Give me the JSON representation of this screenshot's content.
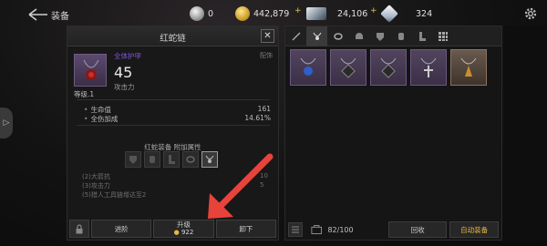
{
  "topbar": {
    "title": "装备",
    "currencies": [
      {
        "name": "silver-orb",
        "value": "0"
      },
      {
        "name": "gold-coin",
        "value": "442,879"
      },
      {
        "name": "crystal",
        "value": "24,106"
      },
      {
        "name": "diamond",
        "value": "324"
      }
    ],
    "plus": "+"
  },
  "item": {
    "title": "红蛇链",
    "type": "全体护甲",
    "slot": "配饰",
    "power": "45",
    "power_label": "攻击力",
    "level": "等级.1",
    "stats": [
      {
        "label": "生命值",
        "value": "161"
      },
      {
        "label": "全伤加成",
        "value": "14.61%"
      }
    ],
    "bonus_title": "红蛇装备 附加属性",
    "set_lines": [
      {
        "label": "(2)大箭抗",
        "value": "10"
      },
      {
        "label": "(3)攻击力",
        "value": "5"
      },
      {
        "label": "(5)猎人工具链增达至2",
        "value": ""
      }
    ],
    "buttons": {
      "advance": "进阶",
      "upgrade": "升级",
      "upgrade_cost": "922",
      "unequip": "卸下"
    }
  },
  "inventory": {
    "capacity": "82/100",
    "recycle": "回收",
    "auto_equip": "自动装备"
  },
  "colors": {
    "accent_gold": "#e7b944",
    "type_purple": "#7b5ad8",
    "arrow_red": "#e8433a"
  }
}
